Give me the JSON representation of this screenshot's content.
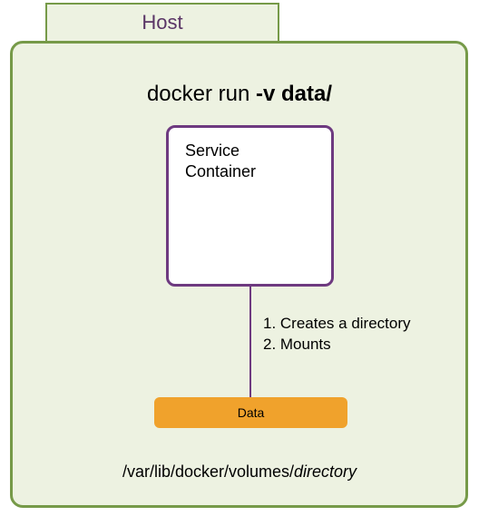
{
  "host": {
    "label": "Host"
  },
  "title": {
    "prefix": "docker run ",
    "bold": "-v data/"
  },
  "service": {
    "line1": "Service",
    "line2": "Container"
  },
  "steps": {
    "line1": "1. Creates a directory",
    "line2": "2. Mounts"
  },
  "data_box": {
    "label": "Data"
  },
  "path": {
    "prefix": "/var/lib/docker/volumes/",
    "italic": "directory"
  }
}
